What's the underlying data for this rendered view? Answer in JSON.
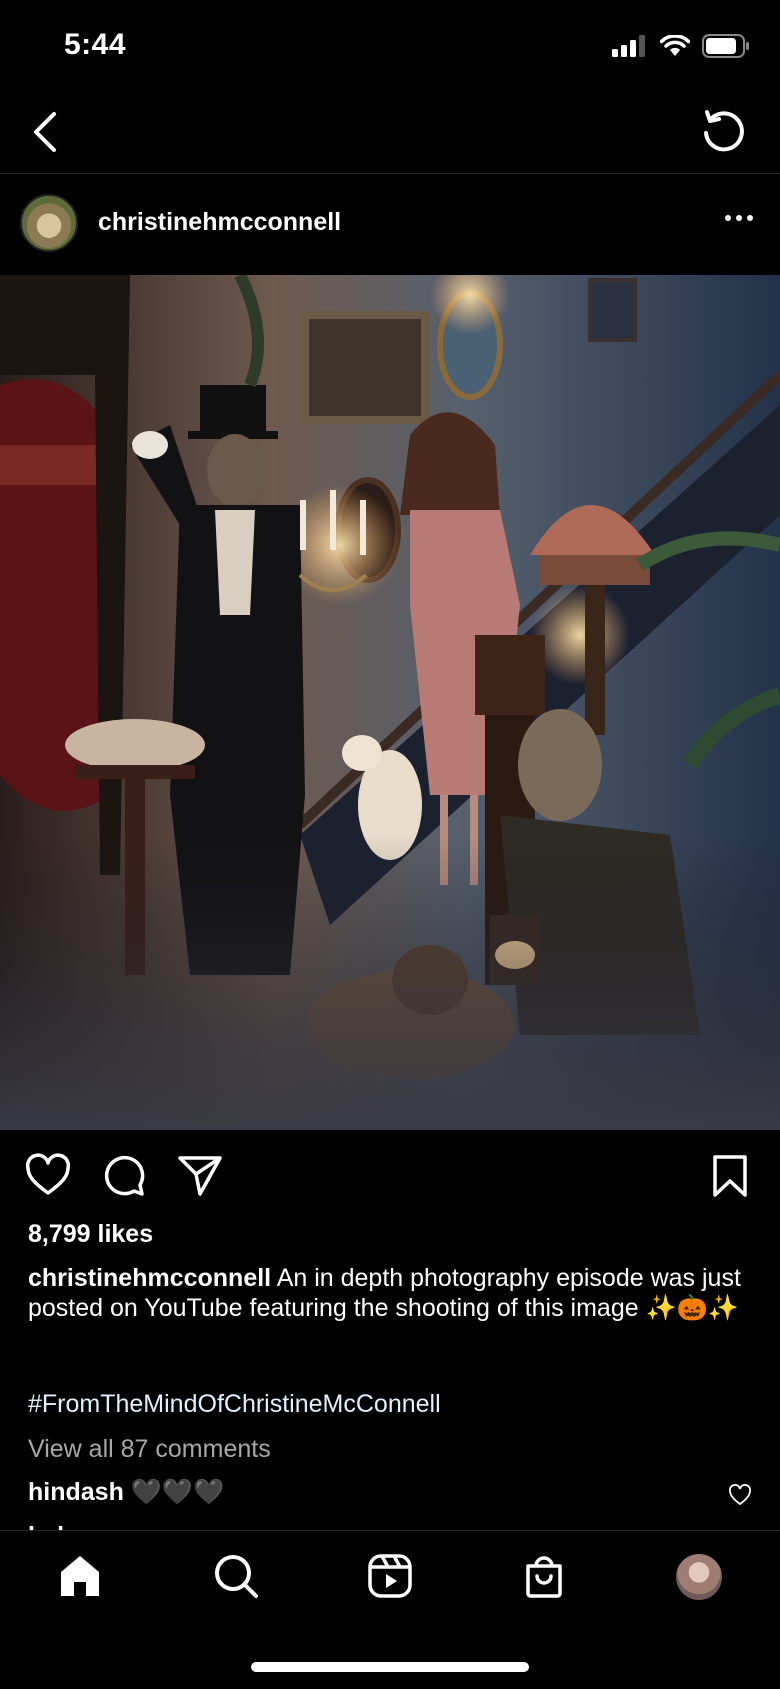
{
  "status_bar": {
    "time": "5:44",
    "icons": [
      "signal-icon",
      "wifi-icon",
      "battery-icon"
    ]
  },
  "nav": {
    "back_icon": "chevron-left-icon",
    "refresh_icon": "refresh-icon"
  },
  "post": {
    "username": "christinehmcconnell",
    "more_icon": "more-horizontal-icon",
    "photo_description_icon": "photo",
    "actions": [
      "heart-icon",
      "comment-icon",
      "share-icon",
      "bookmark-icon"
    ],
    "likes": "8,799 likes",
    "caption_username": "christinehmcconnell",
    "caption_text": " An in depth photography episode was just posted on YouTube featuring the shooting of this image ✨🎃✨",
    "hashtag": "#FromTheMindOfChristineMcConnell",
    "view_all_comments": "View all 87 comments",
    "comments": [
      {
        "username": "hindash",
        "text": " 🖤🖤🖤"
      },
      {
        "username": "helena...",
        "text": ""
      }
    ]
  },
  "tab_bar": {
    "items": [
      "home-icon",
      "search-icon",
      "reels-icon",
      "shop-icon",
      "profile-avatar"
    ]
  },
  "colors": {
    "background": "#000000",
    "text": "#ffffff",
    "secondary_text": "#a8a8a8",
    "divider": "#262626"
  }
}
